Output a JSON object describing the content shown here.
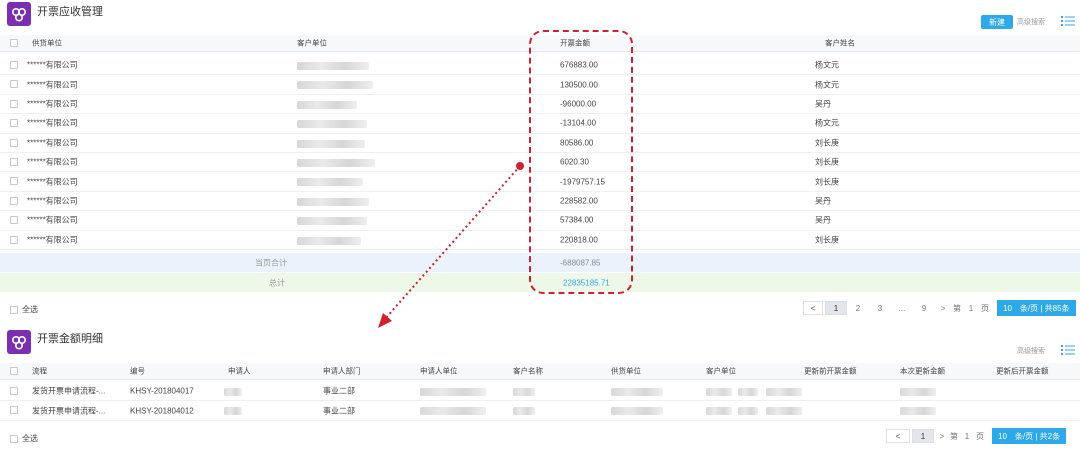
{
  "top_panel": {
    "title": "开票应收管理",
    "new_button": "新建",
    "advanced_search": "高级搜索",
    "columns": [
      "供货单位",
      "客户单位",
      "开票金额",
      "客户姓名"
    ],
    "rows": [
      {
        "supplier": "******有限公司",
        "amount": "676883.00",
        "name": "杨文元"
      },
      {
        "supplier": "******有限公司",
        "amount": "130500.00",
        "name": "杨文元"
      },
      {
        "supplier": "******有限公司",
        "amount": "-96000.00",
        "name": "吴丹"
      },
      {
        "supplier": "******有限公司",
        "amount": "-13104.00",
        "name": "杨文元"
      },
      {
        "supplier": "******有限公司",
        "amount": "80586.00",
        "name": "刘长庚"
      },
      {
        "supplier": "******有限公司",
        "amount": "6020.30",
        "name": "刘长庚"
      },
      {
        "supplier": "******有限公司",
        "amount": "-1979757.15",
        "name": "刘长庚"
      },
      {
        "supplier": "******有限公司",
        "amount": "228582.00",
        "name": "吴丹"
      },
      {
        "supplier": "******有限公司",
        "amount": "57384.00",
        "name": "吴丹"
      },
      {
        "supplier": "******有限公司",
        "amount": "220818.00",
        "name": "刘长庚"
      }
    ],
    "page_total_label": "当页合计",
    "page_total_value": "-688087.85",
    "grand_total_label": "总计",
    "grand_total_value": "22835185.71",
    "select_all": "全选",
    "pager": {
      "prev": "<",
      "pages": [
        "1",
        "2",
        "3",
        "...",
        "9"
      ],
      "next": ">",
      "goto_prefix": "第",
      "goto_value": "1",
      "goto_suffix": "页",
      "per_page": "10",
      "per_page_text": "条/页 | 共85条"
    }
  },
  "bottom_panel": {
    "title": "开票金额明细",
    "advanced_search": "高级搜索",
    "columns": [
      "流程",
      "编号",
      "申请人",
      "申请人部门",
      "申请人单位",
      "客户名称",
      "供货单位",
      "客户单位",
      "更新前开票金额",
      "本次更新金额",
      "更新后开票金额"
    ],
    "rows": [
      {
        "flow": "发货开票申请流程-...",
        "code": "KHSY-201804017",
        "dept": "事业二部"
      },
      {
        "flow": "发货开票申请流程-...",
        "code": "KHSY-201804012",
        "dept": "事业二部"
      }
    ],
    "select_all": "全选",
    "pager": {
      "prev": "<",
      "pages": [
        "1"
      ],
      "next": ">",
      "goto_prefix": "第",
      "goto_value": "1",
      "goto_suffix": "页",
      "per_page": "10",
      "per_page_text": "条/页 | 共2条"
    }
  },
  "colors": {
    "accent": "#2da8e8",
    "logo": "#7b2fb0",
    "highlight": "#cf2130",
    "page_total_bg": "#eaf3fb",
    "grand_total_bg": "#eef8e8"
  }
}
